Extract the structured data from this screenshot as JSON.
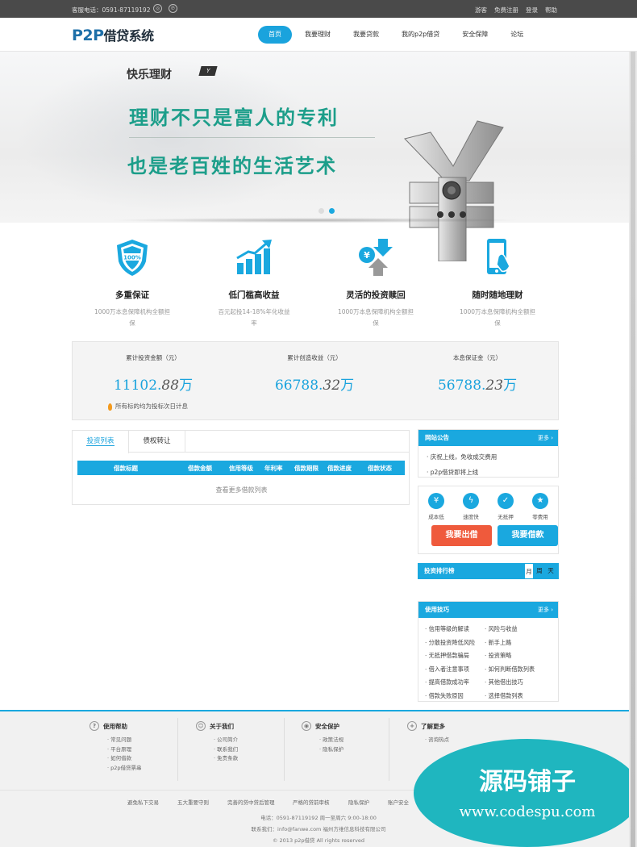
{
  "topbar": {
    "phone": "客服电话：0591-87119192",
    "icons": [
      "weibo-icon",
      "tencent-weibo-icon"
    ],
    "links": [
      "游客",
      "免费注册",
      "登录",
      "帮助"
    ]
  },
  "header": {
    "logo_en": "P2P",
    "logo_cn": "借贷系统",
    "nav": [
      "首页",
      "我要理财",
      "我要贷款",
      "我的p2p借贷",
      "安全保障",
      "论坛"
    ],
    "active_nav": "首页"
  },
  "banner": {
    "small_title": "快乐理财",
    "tag": "Y",
    "line1": "理财不只是富人的专利",
    "line2": "也是老百姓的生活艺术",
    "slides": 2,
    "active_slide": 2
  },
  "features": [
    {
      "icon": "shield-100-icon",
      "title": "多重保证",
      "desc": "1000万本息保障机构全额担保"
    },
    {
      "icon": "bar-chart-growth-icon",
      "title": "低门槛高收益",
      "desc": "百元起投14-18%年化收益率"
    },
    {
      "icon": "exchange-yen-icon",
      "title": "灵活的投资赎回",
      "desc": "1000万本息保障机构全额担保"
    },
    {
      "icon": "mobile-phone-icon",
      "title": "随时随地理财",
      "desc": "1000万本息保障机构全额担保"
    }
  ],
  "stats": {
    "items": [
      {
        "label": "累计投资金额（元）",
        "int": "11102.",
        "dec": "88",
        "unit": "万"
      },
      {
        "label": "累计创造收益（元）",
        "int": "66788.",
        "dec": "32",
        "unit": "万"
      },
      {
        "label": "本息保证金（元）",
        "int": "56788.",
        "dec": "23",
        "unit": "万"
      }
    ],
    "note": "所有标的均为投标次日计息"
  },
  "invest": {
    "tabs": [
      "投资列表",
      "债权转让"
    ],
    "active_tab": "投资列表",
    "columns": [
      "借款标题",
      "借款金额",
      "信用等级",
      "年利率",
      "借款期限",
      "借款进度",
      "借款状态"
    ],
    "more": "查看更多借款列表"
  },
  "notice": {
    "title": "网站公告",
    "more": "更多",
    "items": [
      "庆祝上线，免收成交费用",
      "p2p借贷即将上线"
    ]
  },
  "advantages": {
    "items": [
      {
        "icon": "yen-circle-icon",
        "label": "成本低"
      },
      {
        "icon": "lightning-icon",
        "label": "速度快"
      },
      {
        "icon": "shield-check-icon",
        "label": "无抵押"
      },
      {
        "icon": "star-icon",
        "label": "零费用"
      }
    ],
    "lend_button": "我要出借",
    "borrow_button": "我要借款",
    "colors": {
      "lend": "#ef5a3c",
      "borrow": "#1aa8df"
    }
  },
  "ranking": {
    "title": "投资排行榜",
    "tabs": [
      "月",
      "周",
      "天"
    ],
    "active_tab": "月"
  },
  "tips": {
    "title": "使用技巧",
    "more": "更多",
    "left": [
      "信用等级的解读",
      "分散投资降低风险",
      "无抵押借款骗局",
      "借入者注意事项",
      "提高借款成功率",
      "借款失败原因"
    ],
    "right": [
      "风险与收益",
      "新手上路",
      "投资策略",
      "如何判断借款列表",
      "其他借出技巧",
      "选择借款列表"
    ]
  },
  "footer": {
    "cols": [
      {
        "icon": "question-icon",
        "title": "使用帮助",
        "items": [
          "常见问题",
          "平台原理",
          "如何借款",
          "p2p借贷票串"
        ]
      },
      {
        "icon": "people-icon",
        "title": "关于我们",
        "items": [
          "公司简介",
          "联系我们",
          "免责条款"
        ]
      },
      {
        "icon": "security-icon",
        "title": "安全保护",
        "items": [
          "政策法规",
          "隐私保护"
        ]
      },
      {
        "icon": "plus-circle-icon",
        "title": "了解更多",
        "items": [
          "咨询热点"
        ]
      }
    ],
    "links": [
      "避免私下交易",
      "五大重要守则",
      "完善的贷中贷后管理",
      "严格的贷前审核",
      "隐私保护",
      "账户安全"
    ],
    "contact": "电话：0591-87119192 周一至周六 9:00-18:00",
    "contact2": "联系我们：info@fanwe.com  福州方维信息科技有限公司",
    "copyright": "© 2013 p2p借贷 All rights reserved"
  },
  "watermark": {
    "line1": "源码铺子",
    "line2": "www.codespu.com"
  }
}
